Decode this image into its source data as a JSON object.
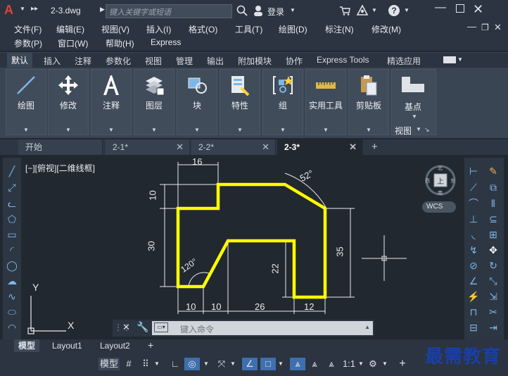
{
  "app": {
    "logo": "A",
    "doc_name": "2-3.dwg",
    "search_placeholder": "键入关键字或短语",
    "login": "登录",
    "help": "?"
  },
  "menu": {
    "row1": [
      "文件(F)",
      "编辑(E)",
      "视图(V)",
      "插入(I)",
      "格式(O)",
      "工具(T)",
      "绘图(D)",
      "标注(N)",
      "修改(M)"
    ],
    "row2": [
      "参数(P)",
      "窗口(W)",
      "帮助(H)",
      "Express"
    ]
  },
  "ribbon_tabs": [
    "默认",
    "插入",
    "注释",
    "参数化",
    "视图",
    "管理",
    "输出",
    "附加模块",
    "协作",
    "Express Tools",
    "精选应用"
  ],
  "panels": [
    {
      "label": "绘图",
      "icon": "draw-icon"
    },
    {
      "label": "修改",
      "icon": "move-icon"
    },
    {
      "label": "注释",
      "icon": "text-icon"
    },
    {
      "label": "图层",
      "icon": "layers-icon"
    },
    {
      "label": "块",
      "icon": "block-icon"
    },
    {
      "label": "特性",
      "icon": "properties-icon"
    },
    {
      "label": "组",
      "icon": "group-icon"
    },
    {
      "label": "实用工具",
      "icon": "ruler-icon"
    },
    {
      "label": "剪贴板",
      "icon": "clipboard-icon"
    },
    {
      "label": "基点",
      "icon": "basepoint-icon"
    }
  ],
  "view_label": "视图",
  "doc_tabs": [
    {
      "label": "开始"
    },
    {
      "label": "2-1*"
    },
    {
      "label": "2-2*"
    },
    {
      "label": "2-3*"
    }
  ],
  "viewport_label": "[−][俯视][二维线框]",
  "viewcube": {
    "top": "上",
    "north": "北",
    "south": "南",
    "west": "西",
    "east": "东",
    "wcs": "WCS"
  },
  "dims": {
    "d16": "16",
    "d10top": "10",
    "d30": "30",
    "d52": "52°",
    "d35": "35",
    "d22": "22",
    "d120": "120°",
    "b10a": "10",
    "b10b": "10",
    "b26": "26",
    "b12": "12"
  },
  "ucs": {
    "y": "Y",
    "x": "X"
  },
  "command_placeholder": "键入命令",
  "layout_tabs": [
    "模型",
    "Layout1",
    "Layout2"
  ],
  "status": {
    "model": "模型",
    "scale": "1:1"
  },
  "watermark": "最需教育"
}
